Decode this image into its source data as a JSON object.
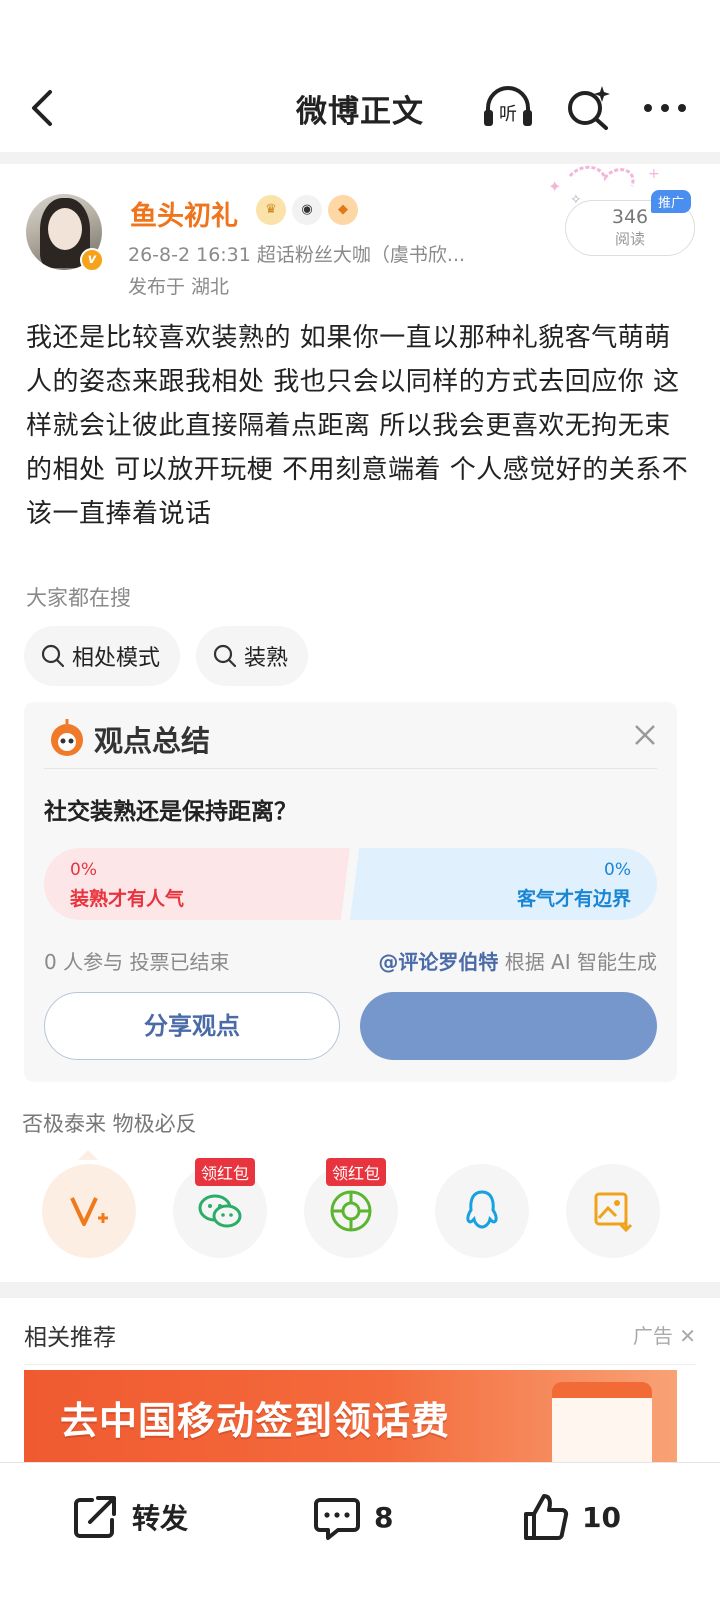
{
  "header": {
    "title": "微博正文",
    "listen_label": "听"
  },
  "post": {
    "username": "鱼头初礼",
    "meta": "26-8-2 16:31  超话粉丝大咖（虞书欣...",
    "location": "发布于 湖北",
    "read_count": "346",
    "read_label": "阅读",
    "promo_tag": "推广",
    "content": "我还是比较喜欢装熟的 如果你一直以那种礼貌客气萌萌人的姿态来跟我相处 我也只会以同样的方式去回应你 这样就会让彼此直接隔着点距离 所以我会更喜欢无拘无束的相处 可以放开玩梗 不用刻意端着 个人感觉好的关系不该一直捧着说话"
  },
  "hot_search": {
    "label": "大家都在搜",
    "chips": [
      "相处模式",
      "装熟"
    ]
  },
  "summary": {
    "title": "观点总结",
    "question": "社交装熟还是保持距离？",
    "left": {
      "percent": "0%",
      "label": "装熟才有人气"
    },
    "right": {
      "percent": "0%",
      "label": "客气才有边界"
    },
    "participants": "0 人参与  投票已结束",
    "ai_author": "@评论罗伯特",
    "ai_suffix": " 根据 AI 智能生成",
    "share_label": "分享观点"
  },
  "proverb": "否极泰来 物极必反",
  "share_targets": [
    {
      "name": "vplus",
      "badge": ""
    },
    {
      "name": "wechat",
      "badge": "领红包"
    },
    {
      "name": "moments",
      "badge": "领红包"
    },
    {
      "name": "qq",
      "badge": ""
    },
    {
      "name": "save-image",
      "badge": ""
    }
  ],
  "recommend": {
    "title": "相关推荐",
    "ad_label": "广告",
    "banner_text": "去中国移动签到领话费"
  },
  "bottom": {
    "repost": "转发",
    "comments": "8",
    "likes": "10"
  },
  "colors": {
    "accent_orange": "#f0741b",
    "vote_red": "#e8343e",
    "vote_blue": "#1a86d4",
    "link_blue": "#4a6aa8"
  }
}
